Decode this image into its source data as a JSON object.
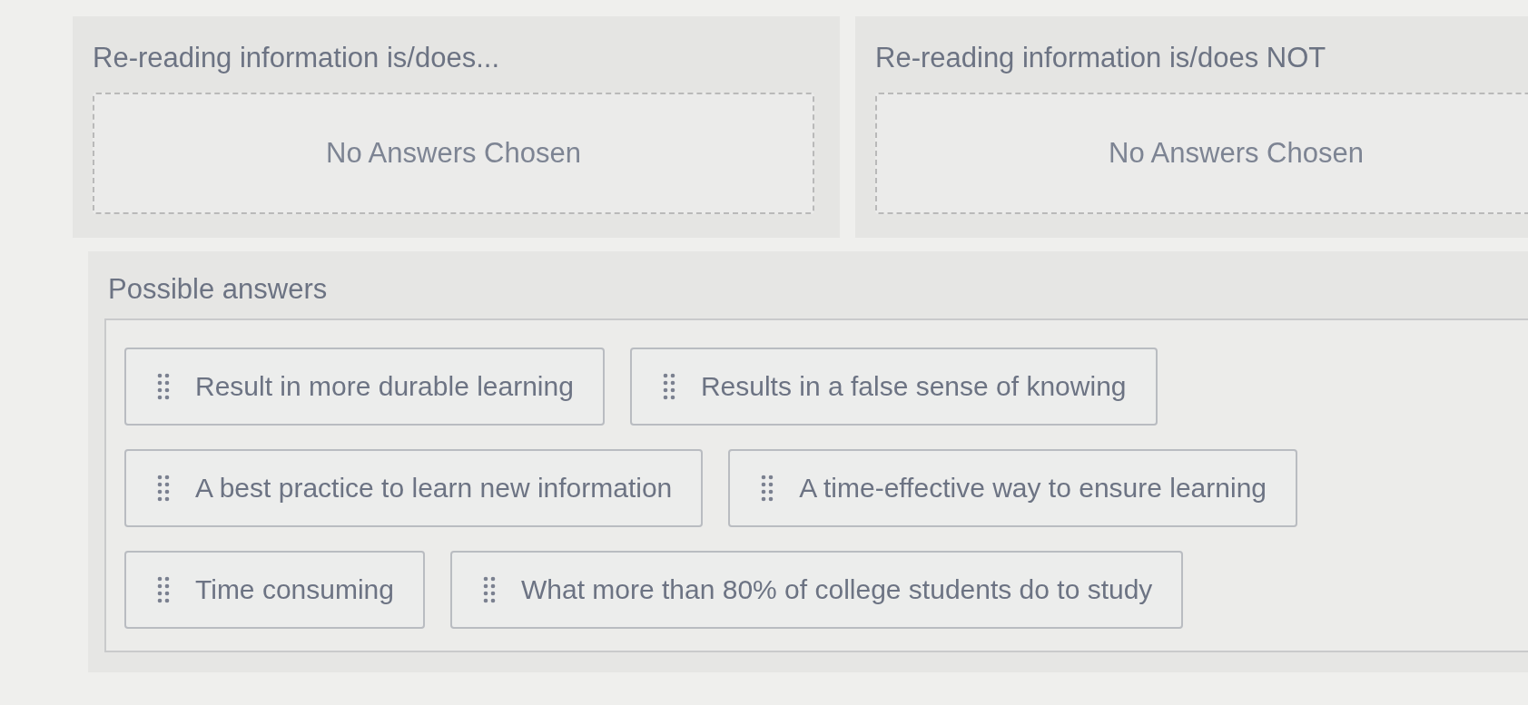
{
  "drop_zones": [
    {
      "title": "Re-reading information is/does...",
      "empty_text": "No Answers Chosen"
    },
    {
      "title": "Re-reading information is/does NOT",
      "empty_text": "No Answers Chosen"
    }
  ],
  "answer_bank": {
    "title": "Possible answers",
    "answers": [
      "Result in more durable learning",
      "Results in a false sense of knowing",
      "A best practice to learn new information",
      "A time-effective way to ensure learning",
      "Time consuming",
      "What more than 80% of college students do to study"
    ]
  }
}
